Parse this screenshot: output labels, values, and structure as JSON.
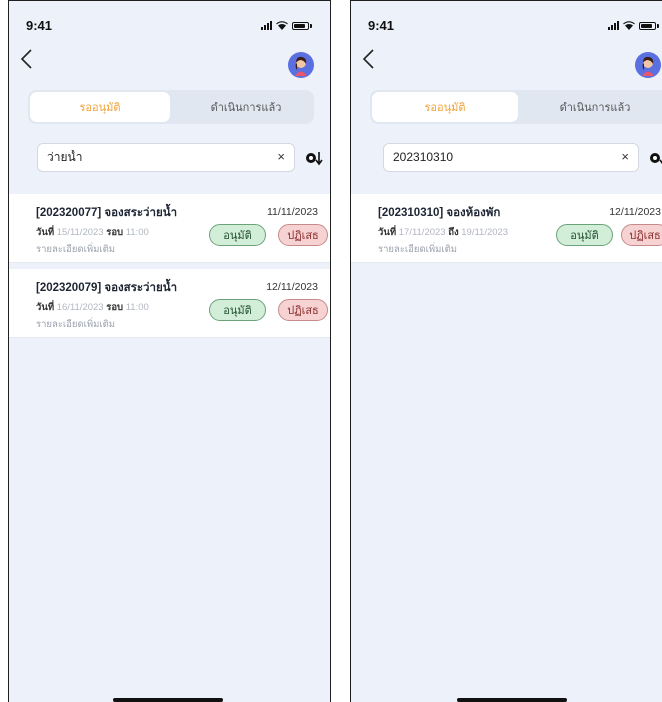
{
  "screens": [
    {
      "status_time": "9:41",
      "tabs": {
        "pending": "รออนุมัติ",
        "done": "ดำเนินการแล้ว"
      },
      "search": {
        "value": "ว่ายน้ำ",
        "clear": "×"
      },
      "cards": [
        {
          "title": "[202320077] จองสระว่ายน้ำ",
          "date": "11/11/2023",
          "day_label": "วันที่",
          "day_value": "15/11/2023",
          "round_label": "รอบ",
          "round_value": "11:00",
          "details": "รายละเอียดเพิ่มเติม",
          "approve": "อนุมัติ",
          "reject": "ปฏิเสธ"
        },
        {
          "title": "[202320079] จองสระว่ายน้ำ",
          "date": "12/11/2023",
          "day_label": "วันที่",
          "day_value": "16/11/2023",
          "round_label": "รอบ",
          "round_value": "11:00",
          "details": "รายละเอียดเพิ่มเติม",
          "approve": "อนุมัติ",
          "reject": "ปฏิเสธ"
        }
      ]
    },
    {
      "status_time": "9:41",
      "tabs": {
        "pending": "รออนุมัติ",
        "done": "ดำเนินการแล้ว"
      },
      "search": {
        "value": "202310310",
        "clear": "×"
      },
      "cards": [
        {
          "title": "[202310310] จองห้องพัก",
          "date": "12/11/2023",
          "day_label": "วันที่",
          "day_value": "17/11/2023",
          "round_label": "ถึง",
          "round_value": "19/11/2023",
          "details": "รายละเอียดเพิ่มเติม",
          "approve": "อนุมัติ",
          "reject": "ปฏิเสธ"
        }
      ]
    }
  ],
  "colors": {
    "accent": "#f0a239",
    "approve_bg": "#d3eed8",
    "reject_bg": "#f6d2d2",
    "screen_bg": "#edf2fa"
  },
  "icons": [
    "back-chevron-icon",
    "avatar-icon",
    "signal-icon",
    "wifi-icon",
    "battery-icon",
    "clear-icon",
    "sort-icon"
  ]
}
